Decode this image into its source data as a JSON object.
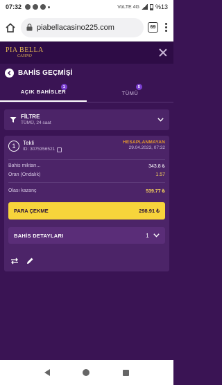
{
  "statusbar": {
    "time": "07:32",
    "system_icons": "VoLTE 4G",
    "battery": "%13"
  },
  "browser": {
    "url": "piabellacasino225.com",
    "tab_count": "69"
  },
  "site": {
    "logo_main": "PIA BELLA",
    "logo_sub": "CASINO"
  },
  "page": {
    "title": "BAHİS GEÇMİŞİ"
  },
  "tabs": [
    {
      "label": "AÇIK BAHİSLER",
      "badge": "1",
      "active": true
    },
    {
      "label": "TÜMÜ",
      "badge": "5",
      "active": false
    }
  ],
  "filter": {
    "title": "FİLTRE",
    "subtitle": "TÜMÜ, 24 saat"
  },
  "bet": {
    "number": "1",
    "type": "Tekli",
    "id": "ID: 3075356521",
    "status": "HESAPLANMAYAN",
    "date": "29.04.2023, 07:32",
    "stake_label": "Bahis miktarı...",
    "stake_value": "343.8 ₺",
    "odds_label": "Oran (Ondalık)",
    "odds_value": "1.57",
    "possible_win_label": "Olası kazanç",
    "possible_win_value": "539.77 ₺",
    "cashout_label": "PARA ÇEKME",
    "cashout_value": "298.91 ₺",
    "details_label": "BAHİS DETAYLARI",
    "details_count": "1"
  },
  "colors": {
    "background": "#3a1454",
    "panel": "#4c2468",
    "accent_yellow": "#f7d43b",
    "status_orange": "#e59a2c",
    "badge_purple": "#7b3fd0"
  }
}
